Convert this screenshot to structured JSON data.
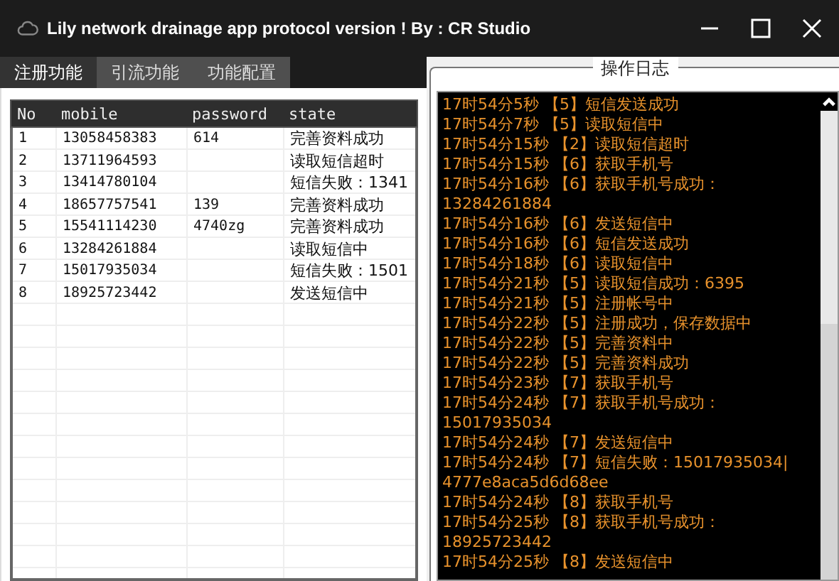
{
  "window": {
    "title": "Lily network drainage app protocol version ! By : CR Studio"
  },
  "tabs": [
    {
      "label": "注册功能",
      "selected": true
    },
    {
      "label": "引流功能",
      "selected": false
    },
    {
      "label": "功能配置",
      "selected": false
    }
  ],
  "table": {
    "columns": [
      "No",
      "mobile",
      "password",
      "state"
    ],
    "rows": [
      [
        "1",
        "13058458383",
        "614",
        "完善资料成功"
      ],
      [
        "2",
        "13711964593",
        "",
        "读取短信超时"
      ],
      [
        "3",
        "13414780104",
        "",
        "短信失败：1341"
      ],
      [
        "4",
        "18657757541",
        "139",
        "完善资料成功"
      ],
      [
        "5",
        "15541114230",
        "4740zg",
        "完善资料成功"
      ],
      [
        "6",
        "13284261884",
        "",
        "读取短信中"
      ],
      [
        "7",
        "15017935034",
        "",
        "短信失败：1501"
      ],
      [
        "8",
        "18925723442",
        "",
        "发送短信中"
      ]
    ]
  },
  "log": {
    "title": "操作日志",
    "lines": [
      "17时54分5秒 【5】短信发送成功",
      "17时54分7秒 【5】读取短信中",
      "17时54分15秒 【2】读取短信超时",
      "17时54分15秒 【6】获取手机号",
      "17时54分16秒 【6】获取手机号成功：",
      "13284261884",
      "17时54分16秒 【6】发送短信中",
      "17时54分16秒 【6】短信发送成功",
      "17时54分18秒 【6】读取短信中",
      "17时54分21秒 【5】读取短信成功：6395",
      "17时54分21秒 【5】注册帐号中",
      "17时54分22秒 【5】注册成功，保存数据中",
      "17时54分22秒 【5】完善资料中",
      "17时54分22秒 【5】完善资料成功",
      "17时54分23秒 【7】获取手机号",
      "17时54分24秒 【7】获取手机号成功：",
      "15017935034",
      "17时54分24秒 【7】发送短信中",
      "17时54分24秒 【7】短信失败：15017935034|",
      "4777e8aca5d6d68ee",
      "17时54分24秒 【8】获取手机号",
      "17时54分25秒 【8】获取手机号成功：",
      "18925723442",
      "17时54分25秒 【8】发送短信中"
    ]
  }
}
